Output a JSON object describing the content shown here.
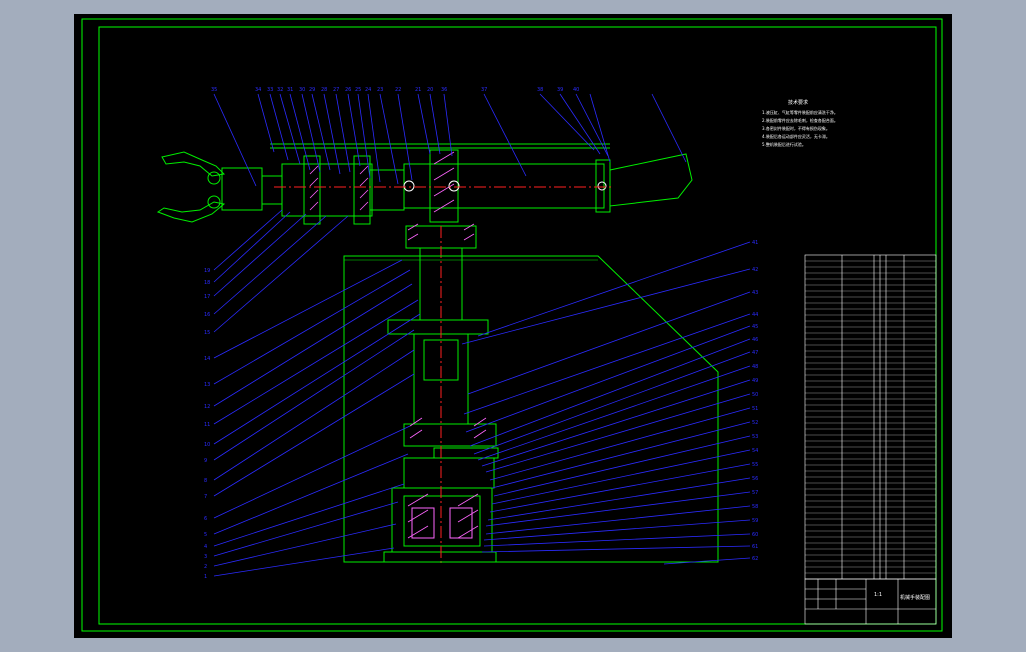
{
  "drawing": {
    "tech_title": "技术要求",
    "tech_notes": [
      "1.液压缸、气缸等零件装配前应清洗干净。",
      "2.装配前零件应去除毛刺，检查各配合面。",
      "3.各密封件装配时，不得有损伤现象。",
      "4.装配后各运动部件应灵活，无卡滞。",
      "5.整机装配后进行试验。"
    ],
    "top_balloons": [
      "35",
      "34",
      "33",
      "32",
      "31",
      "30",
      "29",
      "28",
      "27",
      "26",
      "25",
      "24",
      "23",
      "22",
      "21",
      "20",
      "36",
      "37",
      "38",
      "39",
      "40"
    ],
    "right_balloons": [
      "41",
      "42",
      "43",
      "44",
      "45",
      "46",
      "47",
      "48",
      "49",
      "50",
      "51",
      "52",
      "53",
      "54",
      "55",
      "56",
      "57",
      "58",
      "59",
      "60",
      "61",
      "62"
    ],
    "left_balloons": [
      "19",
      "18",
      "17",
      "16",
      "15",
      "14",
      "13",
      "12",
      "11",
      "10",
      "9",
      "8",
      "7",
      "6",
      "5",
      "4",
      "3",
      "2",
      "1"
    ],
    "title_block": {
      "name": "机械手装配图",
      "scale": "1:1"
    }
  },
  "colors": {
    "paper": "#000000",
    "frame": "#00ff00",
    "outline": "#00ee00",
    "leader": "#2b2bff",
    "centerline": "#ff2020",
    "table": "#ffffff",
    "section": "#ff66ff",
    "dim": "#3355ff"
  }
}
